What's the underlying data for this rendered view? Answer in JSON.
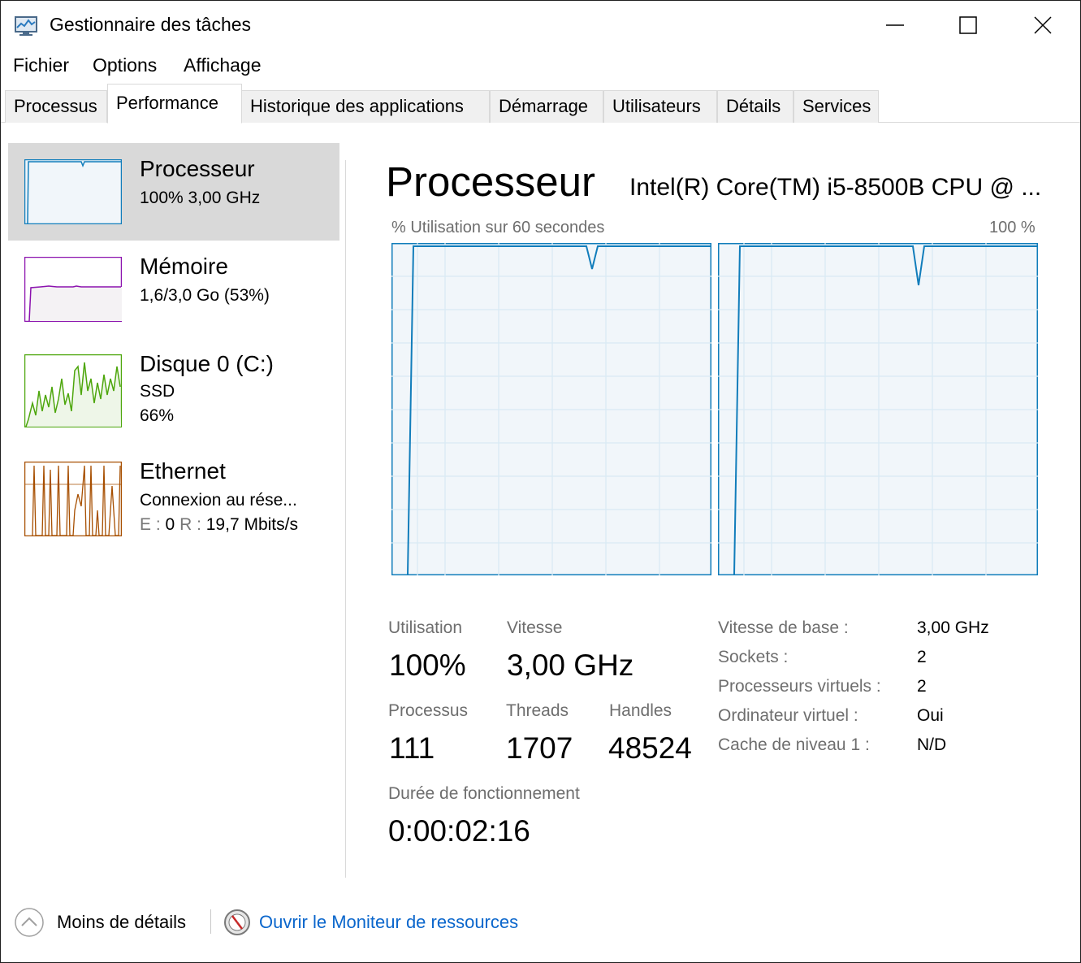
{
  "window": {
    "title": "Gestionnaire des tâches",
    "app_icon": "task-manager-icon"
  },
  "menu": [
    "Fichier",
    "Options",
    "Affichage"
  ],
  "tabs": [
    {
      "label": "Processus",
      "active": false
    },
    {
      "label": "Performance",
      "active": true
    },
    {
      "label": "Historique des applications",
      "active": false
    },
    {
      "label": "Démarrage",
      "active": false
    },
    {
      "label": "Utilisateurs",
      "active": false
    },
    {
      "label": "Détails",
      "active": false
    },
    {
      "label": "Services",
      "active": false
    }
  ],
  "sidebar": {
    "items": [
      {
        "title": "Processeur",
        "line1": "100%  3,00 GHz",
        "line2": "",
        "color": "#117dbb",
        "selected": true
      },
      {
        "title": "Mémoire",
        "line1": "1,6/3,0 Go (53%)",
        "line2": "",
        "color": "#8b12ae",
        "selected": false
      },
      {
        "title": "Disque 0 (C:)",
        "line1": "SSD",
        "line2": "66%",
        "color": "#4da60c",
        "selected": false
      },
      {
        "title": "Ethernet",
        "line1": "Connexion au rése...",
        "line2_prefix_e": "E :",
        "line2_e": "0",
        "line2_prefix_r": "R :",
        "line2_r": "19,7 Mbits/s",
        "color": "#a74f01",
        "selected": false
      }
    ]
  },
  "main": {
    "title": "Processeur",
    "cpu_name": "Intel(R) Core(TM) i5-8500B CPU @ ...",
    "graph_label_left": "% Utilisation sur 60 secondes",
    "graph_label_right": "100 %",
    "graph_color": "#117dbb",
    "stats": {
      "utilisation_label": "Utilisation",
      "utilisation_value": "100%",
      "vitesse_label": "Vitesse",
      "vitesse_value": "3,00 GHz",
      "processus_label": "Processus",
      "processus_value": "111",
      "threads_label": "Threads",
      "threads_value": "1707",
      "handles_label": "Handles",
      "handles_value": "48524",
      "uptime_label": "Durée de fonctionnement",
      "uptime_value": "0:00:02:16"
    },
    "details": [
      {
        "key": "Vitesse de base :",
        "value": "3,00 GHz"
      },
      {
        "key": "Sockets :",
        "value": "2"
      },
      {
        "key": "Processeurs virtuels :",
        "value": "2"
      },
      {
        "key": "Ordinateur virtuel :",
        "value": "Oui"
      },
      {
        "key": "Cache de niveau 1 :",
        "value": "N/D"
      }
    ]
  },
  "footer": {
    "less_details": "Moins de détails",
    "resource_monitor": "Ouvrir le Moniteur de ressources"
  }
}
